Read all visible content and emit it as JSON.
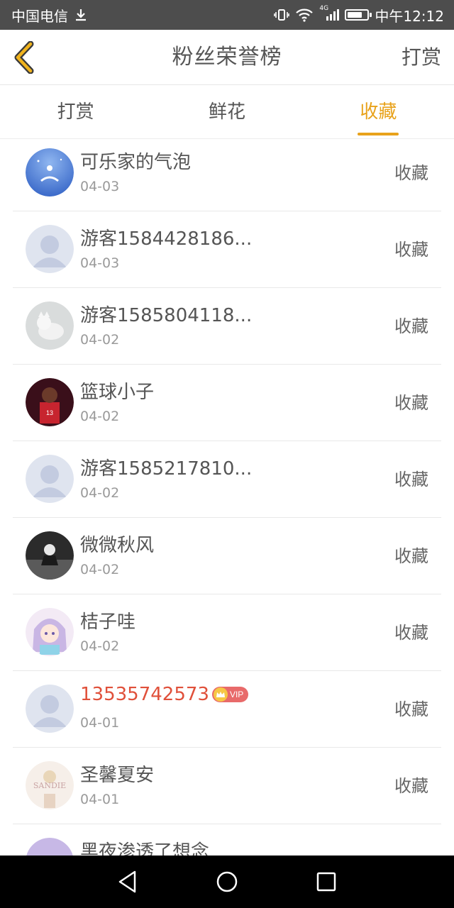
{
  "status_bar": {
    "carrier": "中国电信",
    "network": "4G",
    "time": "中午12:12",
    "battery_level": 0.75
  },
  "header": {
    "title": "粉丝荣誉榜",
    "action_label": "打赏"
  },
  "tabs": [
    {
      "label": "打赏",
      "active": false
    },
    {
      "label": "鲜花",
      "active": false
    },
    {
      "label": "收藏",
      "active": true
    }
  ],
  "list": [
    {
      "name": "可乐家的气泡",
      "date": "04-03",
      "action": "收藏",
      "avatar": "photo-blue"
    },
    {
      "name": "游客1584428186...",
      "date": "04-03",
      "action": "收藏",
      "avatar": "default"
    },
    {
      "name": "游客1585804118...",
      "date": "04-02",
      "action": "收藏",
      "avatar": "photo-cat"
    },
    {
      "name": "篮球小子",
      "date": "04-02",
      "action": "收藏",
      "avatar": "photo-red"
    },
    {
      "name": "游客1585217810...",
      "date": "04-02",
      "action": "收藏",
      "avatar": "default"
    },
    {
      "name": "微微秋风",
      "date": "04-02",
      "action": "收藏",
      "avatar": "photo-dark"
    },
    {
      "name": "桔子哇",
      "date": "04-02",
      "action": "收藏",
      "avatar": "photo-anime"
    },
    {
      "name": "13535742573",
      "date": "04-01",
      "action": "收藏",
      "avatar": "default",
      "vip": "VIP"
    },
    {
      "name": "圣馨夏安",
      "date": "04-01",
      "action": "收藏",
      "avatar": "photo-sandie"
    },
    {
      "name": "黑夜渗透了想念",
      "date": "",
      "action": "",
      "avatar": "photo-purple"
    }
  ],
  "avatar_text": {
    "photo-sandie": "SANDIE"
  },
  "colors": {
    "accent": "#e8a21b",
    "vip_name": "#e0503a",
    "status_bar": "#4d4d4d"
  },
  "icons": {
    "back": "chevron-left-icon",
    "nav": [
      "back-triangle-icon",
      "home-circle-icon",
      "recents-square-icon"
    ]
  }
}
